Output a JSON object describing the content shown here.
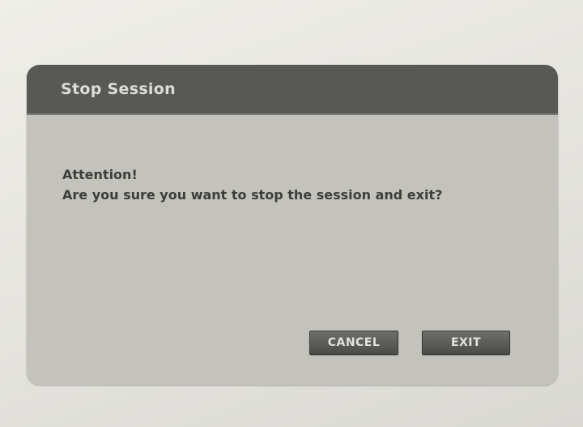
{
  "dialog": {
    "title": "Stop Session",
    "message_line1": "Attention!",
    "message_line2": "Are you sure you want to stop the session and exit?",
    "buttons": {
      "cancel": "CANCEL",
      "exit": "EXIT"
    }
  }
}
